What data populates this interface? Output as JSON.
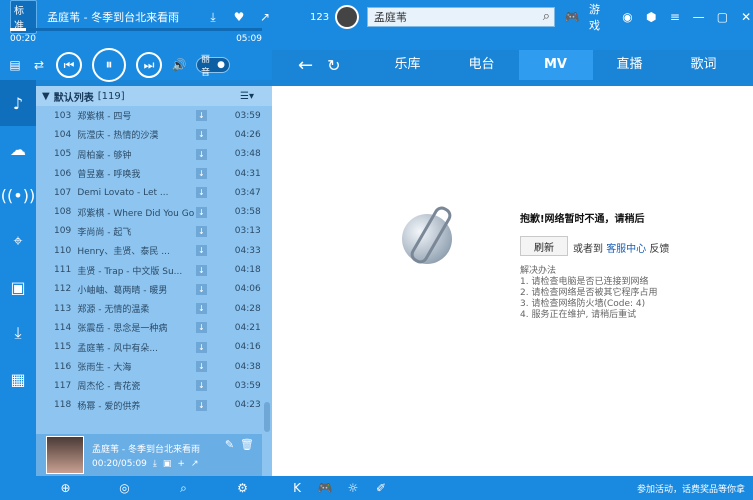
{
  "player": {
    "quality": "标准",
    "song": "孟庭苇 - 冬季到台北来看雨",
    "time_current": "00:20",
    "time_total": "05:09",
    "progress": 0.065,
    "spatial_label": "丽音"
  },
  "top": {
    "count": "123",
    "search_value": "孟庭苇",
    "games_label": "游戏"
  },
  "nav": {
    "tabs": [
      "乐库",
      "电台",
      "MV",
      "直播",
      "歌词"
    ],
    "active_tab": "MV"
  },
  "playlist": {
    "title": "默认列表",
    "count": "[119]",
    "rows": [
      {
        "num": "103",
        "name": "郑紫棋 - 四号",
        "dur": "03:59"
      },
      {
        "num": "104",
        "name": "阮滢庆 - 热情的沙漠",
        "dur": "04:26"
      },
      {
        "num": "105",
        "name": "周柏豪 - 够钟",
        "dur": "03:48"
      },
      {
        "num": "106",
        "name": "曾昱嘉 - 呼唤我",
        "dur": "04:31"
      },
      {
        "num": "107",
        "name": "Demi Lovato - Let ...",
        "dur": "03:47"
      },
      {
        "num": "108",
        "name": "邓紫棋 - Where Did You Go",
        "dur": "03:58"
      },
      {
        "num": "109",
        "name": "李尚尚 - 起飞",
        "dur": "03:13"
      },
      {
        "num": "110",
        "name": "Henry、圭贤、泰民 ...",
        "dur": "04:33"
      },
      {
        "num": "111",
        "name": "圭贤 - Trap - 中文版 Su...",
        "dur": "04:18"
      },
      {
        "num": "112",
        "name": "小岫岫、葛两晴 - 暖男",
        "dur": "04:06"
      },
      {
        "num": "113",
        "name": "郑源 - 无情的温柔",
        "dur": "04:28"
      },
      {
        "num": "114",
        "name": "张震岳 - 思念是一种病",
        "dur": "04:21"
      },
      {
        "num": "115",
        "name": "孟庭苇 - 风中有朵...",
        "dur": "04:16"
      },
      {
        "num": "116",
        "name": "张雨生 - 大海",
        "dur": "04:38"
      },
      {
        "num": "117",
        "name": "周杰伦 - 青花瓷",
        "dur": "03:59"
      },
      {
        "num": "118",
        "name": "杨幂 - 爱的供养",
        "dur": "04:23"
      }
    ],
    "now_playing": {
      "song": "孟庭苇 - 冬季到台北来看雨",
      "time": "00:20/05:09"
    }
  },
  "content": {
    "error_title": "抱歉!网络暂时不通，请稍后",
    "refresh": "刷新",
    "or_text": "或者到",
    "help_link": "客服中心",
    "feedback": "反馈",
    "tips_title": "解决办法",
    "tips": [
      "1. 请检查电脑是否已连接到网络",
      "2. 请检查网络是否被其它程序占用",
      "3. 请检查网络防火墙(Code: 4)",
      "4. 服务正在维护, 请稍后重试"
    ]
  },
  "bottom": {
    "promo": "参加活动，话费奖品等你拿"
  }
}
